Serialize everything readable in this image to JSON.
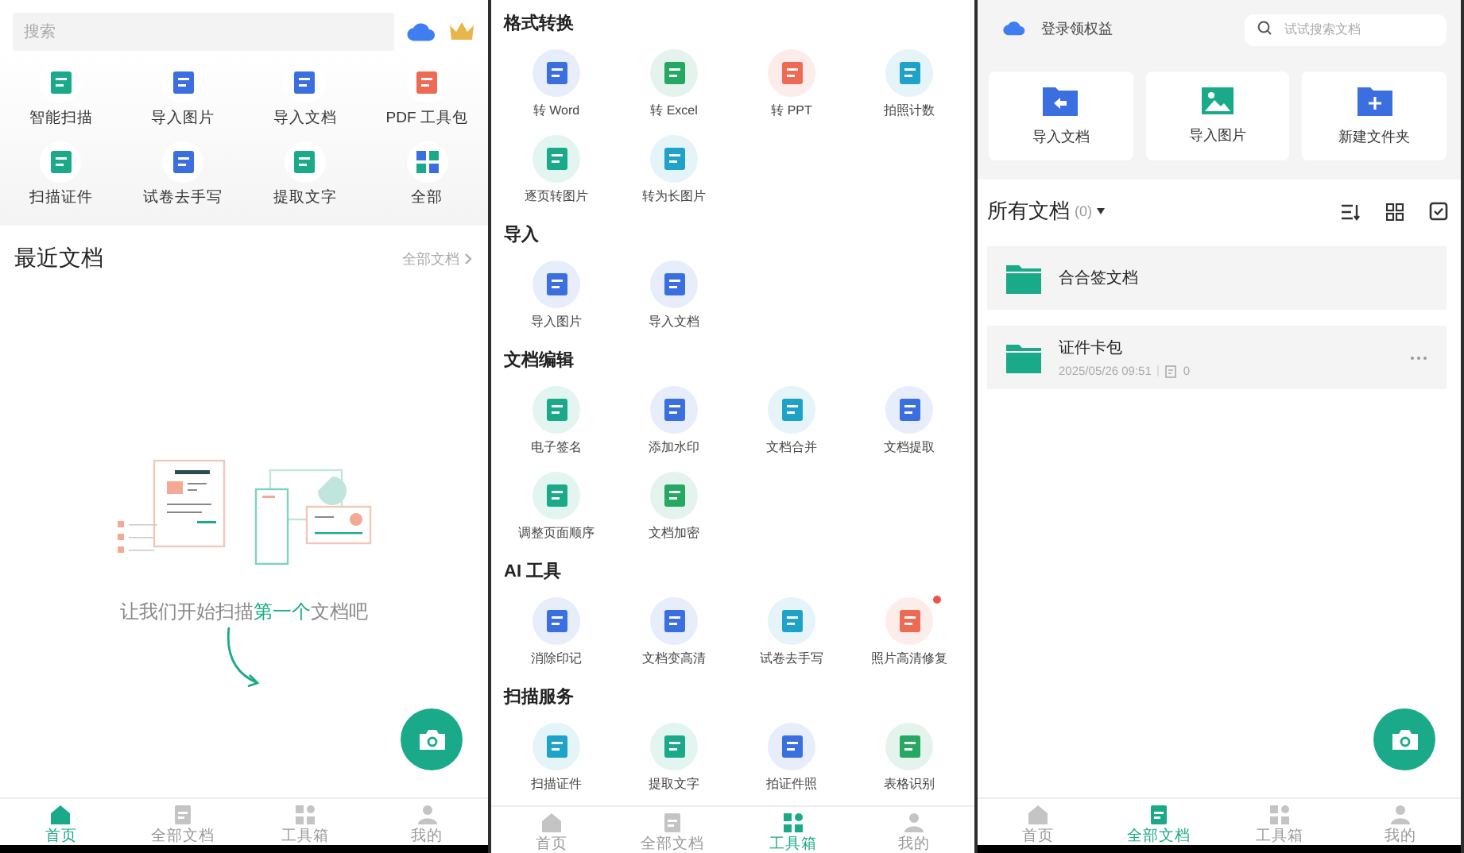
{
  "home_screen": {
    "search": {
      "placeholder": "搜索"
    },
    "quick_actions": [
      "智能扫描",
      "导入图片",
      "导入文档",
      "PDF 工具包",
      "扫描证件",
      "试卷去手写",
      "提取文字",
      "全部"
    ],
    "recent": {
      "title": "最近文档",
      "link": "全部文档"
    },
    "empty_message": {
      "before": "让我们开始扫描",
      "highlight": "第一个",
      "after": "文档吧"
    },
    "tab_bar": [
      {
        "label": "首页",
        "selected": true
      },
      {
        "label": "全部文档",
        "selected": false
      },
      {
        "label": "工具箱",
        "selected": false
      },
      {
        "label": "我的",
        "selected": false
      }
    ]
  },
  "toolbox_screen": {
    "sections": [
      {
        "title": "格式转换",
        "tools": [
          {
            "label": "转 Word",
            "badge": false
          },
          {
            "label": "转 Excel",
            "badge": false
          },
          {
            "label": "转 PPT",
            "badge": false
          },
          {
            "label": "拍照计数",
            "badge": false
          },
          {
            "label": "逐页转图片",
            "badge": false
          },
          {
            "label": "转为长图片",
            "badge": false
          }
        ]
      },
      {
        "title": "导入",
        "tools": [
          {
            "label": "导入图片",
            "badge": false
          },
          {
            "label": "导入文档",
            "badge": false
          }
        ]
      },
      {
        "title": "文档编辑",
        "tools": [
          {
            "label": "电子签名",
            "badge": false
          },
          {
            "label": "添加水印",
            "badge": false
          },
          {
            "label": "文档合并",
            "badge": false
          },
          {
            "label": "文档提取",
            "badge": false
          },
          {
            "label": "调整页面顺序",
            "badge": false
          },
          {
            "label": "文档加密",
            "badge": false
          }
        ]
      },
      {
        "title": "AI 工具",
        "tools": [
          {
            "label": "消除印记",
            "badge": false
          },
          {
            "label": "文档变高清",
            "badge": false
          },
          {
            "label": "试卷去手写",
            "badge": false
          },
          {
            "label": "照片高清修复",
            "badge": true
          }
        ]
      },
      {
        "title": "扫描服务",
        "tools": [
          {
            "label": "扫描证件",
            "badge": false
          },
          {
            "label": "提取文字",
            "badge": false
          },
          {
            "label": "拍证件照",
            "badge": false
          },
          {
            "label": "表格识别",
            "badge": false
          }
        ]
      }
    ],
    "tab_bar": [
      {
        "label": "首页",
        "selected": false
      },
      {
        "label": "全部文档",
        "selected": false
      },
      {
        "label": "工具箱",
        "selected": true
      },
      {
        "label": "我的",
        "selected": false
      }
    ]
  },
  "documents_screen": {
    "login_label": "登录领权益",
    "search": {
      "placeholder": "试试搜索文档"
    },
    "actions": [
      "导入文档",
      "导入图片",
      "新建文件夹"
    ],
    "list_title": "所有文档",
    "count": "(0)",
    "folders": [
      {
        "name": "合合签文档",
        "has_menu": false
      },
      {
        "name": "证件卡包",
        "date": "2025/05/26 09:51",
        "count": "0",
        "has_menu": true
      }
    ],
    "tab_bar": [
      {
        "label": "首页",
        "selected": false
      },
      {
        "label": "全部文档",
        "selected": true
      },
      {
        "label": "工具箱",
        "selected": false
      },
      {
        "label": "我的",
        "selected": false
      }
    ]
  }
}
